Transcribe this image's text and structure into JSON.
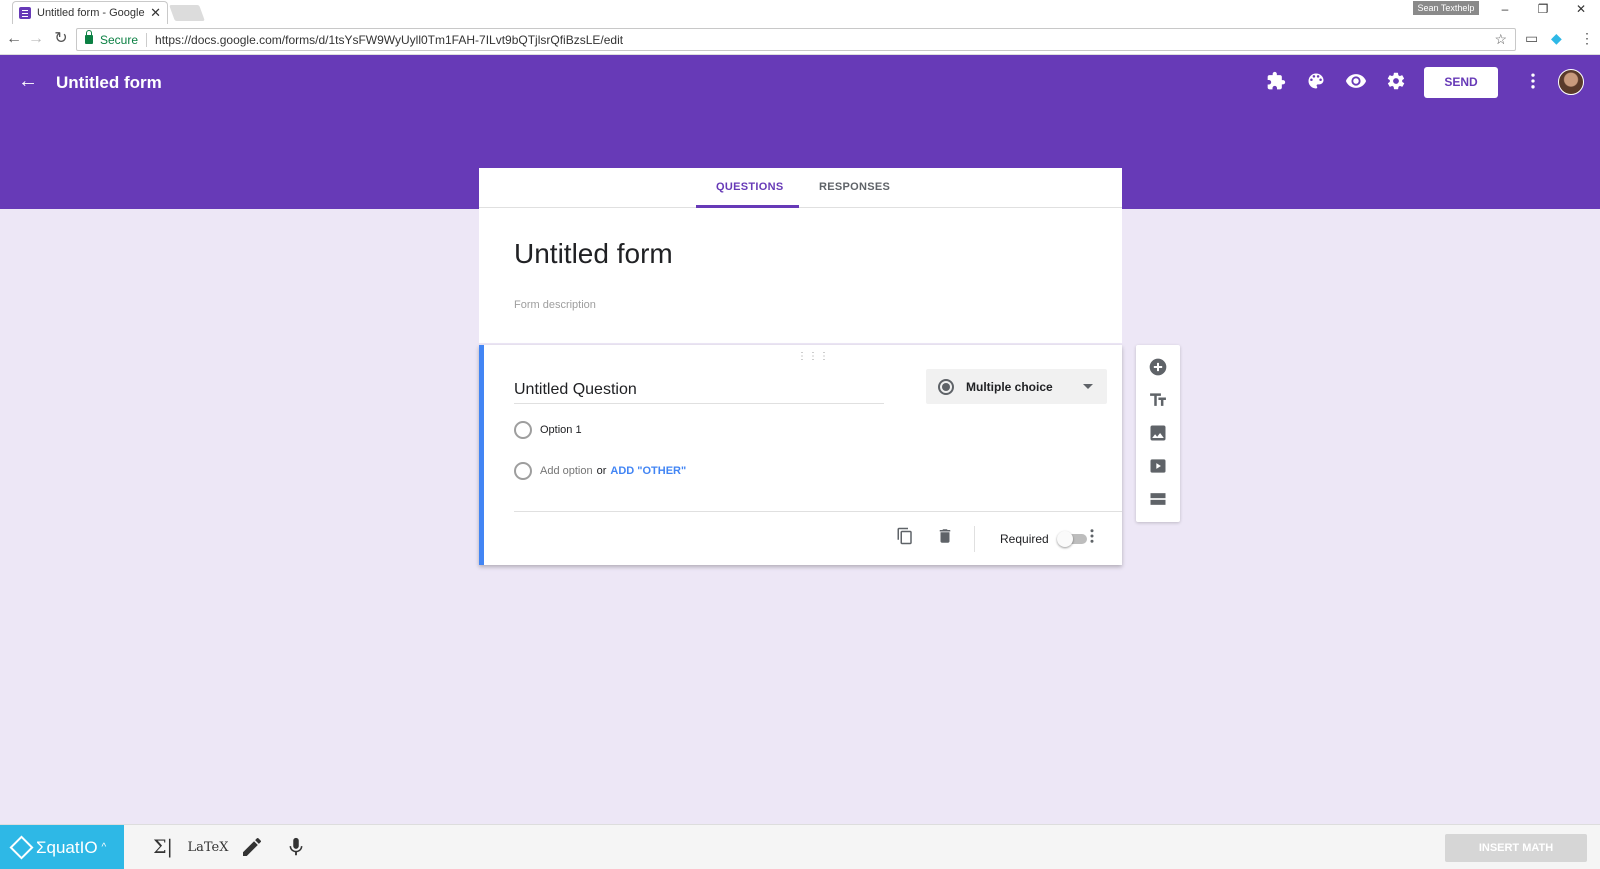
{
  "browser": {
    "tab_title": "Untitled form - Google F",
    "tab_close": "✕",
    "profile_name": "Sean Texthelp",
    "secure_label": "Secure",
    "url": "https://docs.google.com/forms/d/1tsYsFW9WyUyll0Tm1FAH-7ILvt9bQTjlsrQfiBzsLE/edit"
  },
  "header": {
    "title": "Untitled form",
    "send_label": "SEND",
    "icons": [
      "puzzle-icon",
      "palette-icon",
      "eye-icon",
      "gear-icon",
      "more-vert-icon"
    ],
    "color": "#673ab7"
  },
  "tabs": {
    "questions": "QUESTIONS",
    "responses": "RESPONSES"
  },
  "form": {
    "title": "Untitled form",
    "description_placeholder": "Form description"
  },
  "question": {
    "title": "Untitled Question",
    "type": "Multiple choice",
    "options": [
      "Option 1"
    ],
    "add_option": "Add option",
    "or": "or",
    "add_other": "ADD \"OTHER\"",
    "required_label": "Required",
    "required": false
  },
  "side_toolbar": {
    "icons": [
      "add-question-icon",
      "add-title-icon",
      "add-image-icon",
      "add-video-icon",
      "add-section-icon"
    ]
  },
  "equatio": {
    "logo_text": "ƩquatIO",
    "latex_label": "LaTeX",
    "insert_math": "INSERT MATH"
  }
}
